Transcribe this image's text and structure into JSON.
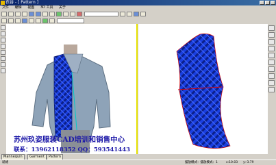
{
  "title_bar": {
    "text": "衣谷 - [ Pattern ]"
  },
  "menu": [
    "文件",
    "编辑",
    "视图",
    "3D 工具",
    "关于"
  ],
  "toolbar": {
    "field1": "",
    "field2": ""
  },
  "banner": {
    "title": "苏州玖姿服装CAD培训和销售中心",
    "contact": "联系：13962118352  QQ：593541443"
  },
  "tabs": [
    "Mannequin",
    "Garment",
    "Pattern"
  ],
  "status": {
    "left": "就绪",
    "center": "摆放模式：摆放模式：1",
    "coords": "x:10.03",
    "coords2": "y:-3.79"
  },
  "colors": {
    "fabric": "#1a3fe0",
    "accent_line": "#e7e300",
    "banner_text": "#1c18a8"
  }
}
